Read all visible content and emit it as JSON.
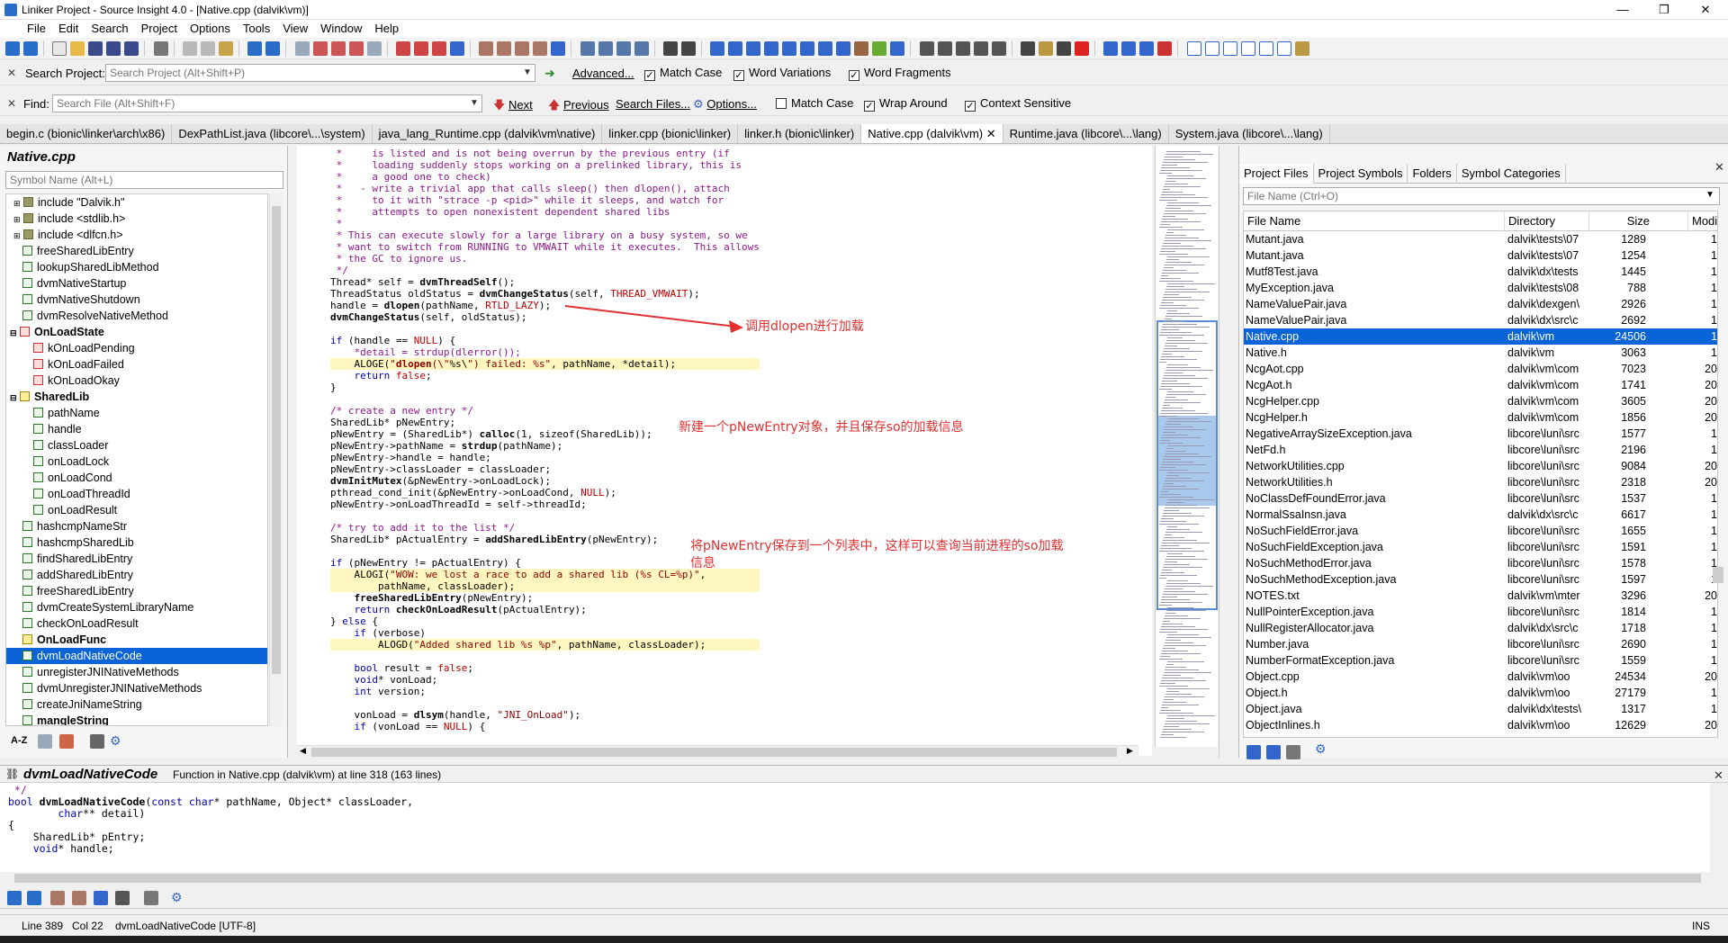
{
  "window": {
    "title": "Liniker Project - Source Insight 4.0 - [Native.cpp (dalvik\\vm)]",
    "minimize": "—",
    "restore": "❐",
    "close": "✕"
  },
  "menu": [
    "File",
    "Edit",
    "Search",
    "Project",
    "Options",
    "Tools",
    "View",
    "Window",
    "Help"
  ],
  "search_project": {
    "label": "Search Project:",
    "placeholder": "Search Project (Alt+Shift+P)",
    "advanced": "Advanced...",
    "match_case": "Match Case",
    "word_variations": "Word Variations",
    "word_fragments": "Word Fragments"
  },
  "find": {
    "label": "Find:",
    "placeholder": "Search File (Alt+Shift+F)",
    "next": "Next",
    "previous": "Previous",
    "search_files": "Search Files...",
    "options": "Options...",
    "match_case": "Match Case",
    "wrap_around": "Wrap Around",
    "context_sensitive": "Context Sensitive"
  },
  "file_tabs": [
    {
      "label": "begin.c (bionic\\linker\\arch\\x86)"
    },
    {
      "label": "DexPathList.java (libcore\\...\\system)"
    },
    {
      "label": "java_lang_Runtime.cpp (dalvik\\vm\\native)"
    },
    {
      "label": "linker.cpp (bionic\\linker)"
    },
    {
      "label": "linker.h (bionic\\linker)"
    },
    {
      "label": "Native.cpp (dalvik\\vm)",
      "close": "✕"
    },
    {
      "label": "Runtime.java (libcore\\...\\lang)"
    },
    {
      "label": "System.java (libcore\\...\\lang)"
    }
  ],
  "symbol_panel": {
    "title": "Native.cpp",
    "placeholder": "Symbol Name (Alt+L)",
    "symbols": [
      "include \"Dalvik.h\"",
      "include <stdlib.h>",
      "include <dlfcn.h>",
      "freeSharedLibEntry",
      "lookupSharedLibMethod",
      "dvmNativeStartup",
      "dvmNativeShutdown",
      "dvmResolveNativeMethod",
      "OnLoadState",
      "kOnLoadPending",
      "kOnLoadFailed",
      "kOnLoadOkay",
      "SharedLib",
      "pathName",
      "handle",
      "classLoader",
      "onLoadLock",
      "onLoadCond",
      "onLoadThreadId",
      "onLoadResult",
      "hashcmpNameStr",
      "hashcmpSharedLib",
      "findSharedLibEntry",
      "addSharedLibEntry",
      "freeSharedLibEntry",
      "dvmCreateSystemLibraryName",
      "checkOnLoadResult",
      "OnLoadFunc",
      "dvmLoadNativeCode",
      "unregisterJNINativeMethods",
      "dvmUnregisterJNINativeMethods",
      "createJniNameString",
      "mangleString"
    ],
    "az": "A-Z"
  },
  "code": {
    "lines": [
      " *     is listed and is not being overrun by the previous entry (if",
      " *     loading suddenly stops working on a prelinked library, this is",
      " *     a good one to check)",
      " *   - write a trivial app that calls sleep() then dlopen(), attach",
      " *     to it with \"strace -p <pid>\" while it sleeps, and watch for",
      " *     attempts to open nonexistent dependent shared libs",
      " *",
      " * This can execute slowly for a large library on a busy system, so we",
      " * want to switch from RUNNING to VMWAIT while it executes.  This allows",
      " * the GC to ignore us.",
      " */",
      "Thread* self = dvmThreadSelf();",
      "ThreadStatus oldStatus = dvmChangeStatus(self, THREAD_VMWAIT);",
      "handle = dlopen(pathName, RTLD_LAZY);",
      "dvmChangeStatus(self, oldStatus);",
      "",
      "if (handle == NULL) {",
      "    *detail = strdup(dlerror());",
      "    ALOGE(\"dlopen(\\\"%s\\\") failed: %s\", pathName, *detail);",
      "    return false;",
      "}",
      "",
      "/* create a new entry */",
      "SharedLib* pNewEntry;",
      "pNewEntry = (SharedLib*) calloc(1, sizeof(SharedLib));",
      "pNewEntry->pathName = strdup(pathName);",
      "pNewEntry->handle = handle;",
      "pNewEntry->classLoader = classLoader;",
      "dvmInitMutex(&pNewEntry->onLoadLock);",
      "pthread_cond_init(&pNewEntry->onLoadCond, NULL);",
      "pNewEntry->onLoadThreadId = self->threadId;",
      "",
      "/* try to add it to the list */",
      "SharedLib* pActualEntry = addSharedLibEntry(pNewEntry);",
      "",
      "if (pNewEntry != pActualEntry) {",
      "    ALOGI(\"WOW: we lost a race to add a shared lib (%s CL=%p)\",",
      "        pathName, classLoader);",
      "    freeSharedLibEntry(pNewEntry);",
      "    return checkOnLoadResult(pActualEntry);",
      "} else {",
      "    if (verbose)",
      "        ALOGD(\"Added shared lib %s %p\", pathName, classLoader);",
      "",
      "    bool result = false;",
      "    void* vonLoad;",
      "    int version;",
      "",
      "    vonLoad = dlsym(handle, \"JNI_OnLoad\");",
      "    if (vonLoad == NULL) {"
    ]
  },
  "annotations": {
    "dlopen": "调用dlopen进行加载",
    "new_entry": "新建一个pNewEntry对象，并且保存so的加载信息",
    "list_line1": "将pNewEntry保存到一个列表中，这样可以查询当前进程的so加载",
    "list_line2": "信息"
  },
  "project_panel": {
    "tabs": [
      "Project Files",
      "Project Symbols",
      "Folders",
      "Symbol Categories"
    ],
    "placeholder": "File Name (Ctrl+O)",
    "columns": [
      "File Name",
      "Directory",
      "Size",
      "Modifi"
    ],
    "files": [
      [
        "Mutant.java",
        "dalvik\\tests\\07",
        "1289",
        "1"
      ],
      [
        "Mutant.java",
        "dalvik\\tests\\07",
        "1254",
        "1"
      ],
      [
        "Mutf8Test.java",
        "dalvik\\dx\\tests",
        "1445",
        "1"
      ],
      [
        "MyException.java",
        "dalvik\\tests\\08",
        "788",
        "1"
      ],
      [
        "NameValuePair.java",
        "dalvik\\dexgen\\",
        "2926",
        "1"
      ],
      [
        "NameValuePair.java",
        "dalvik\\dx\\src\\c",
        "2692",
        "1"
      ],
      [
        "Native.cpp",
        "dalvik\\vm",
        "24506",
        "1"
      ],
      [
        "Native.h",
        "dalvik\\vm",
        "3063",
        "1"
      ],
      [
        "NcgAot.cpp",
        "dalvik\\vm\\com",
        "7023",
        "20"
      ],
      [
        "NcgAot.h",
        "dalvik\\vm\\com",
        "1741",
        "20"
      ],
      [
        "NcgHelper.cpp",
        "dalvik\\vm\\com",
        "3605",
        "20"
      ],
      [
        "NcgHelper.h",
        "dalvik\\vm\\com",
        "1856",
        "20"
      ],
      [
        "NegativeArraySizeException.java",
        "libcore\\luni\\src",
        "1577",
        "1"
      ],
      [
        "NetFd.h",
        "libcore\\luni\\src",
        "2196",
        "1"
      ],
      [
        "NetworkUtilities.cpp",
        "libcore\\luni\\src",
        "9084",
        "20"
      ],
      [
        "NetworkUtilities.h",
        "libcore\\luni\\src",
        "2318",
        "20"
      ],
      [
        "NoClassDefFoundError.java",
        "libcore\\luni\\src",
        "1537",
        "1"
      ],
      [
        "NormalSsaInsn.java",
        "dalvik\\dx\\src\\c",
        "6617",
        "1"
      ],
      [
        "NoSuchFieldError.java",
        "libcore\\luni\\src",
        "1655",
        "1"
      ],
      [
        "NoSuchFieldException.java",
        "libcore\\luni\\src",
        "1591",
        "1"
      ],
      [
        "NoSuchMethodError.java",
        "libcore\\luni\\src",
        "1578",
        "1"
      ],
      [
        "NoSuchMethodException.java",
        "libcore\\luni\\src",
        "1597",
        "1"
      ],
      [
        "NOTES.txt",
        "dalvik\\vm\\mter",
        "3296",
        "20"
      ],
      [
        "NullPointerException.java",
        "libcore\\luni\\src",
        "1814",
        "1"
      ],
      [
        "NullRegisterAllocator.java",
        "dalvik\\dx\\src\\c",
        "1718",
        "1"
      ],
      [
        "Number.java",
        "libcore\\luni\\src",
        "2690",
        "1"
      ],
      [
        "NumberFormatException.java",
        "libcore\\luni\\src",
        "1559",
        "1"
      ],
      [
        "Object.cpp",
        "dalvik\\vm\\oo",
        "24534",
        "20"
      ],
      [
        "Object.h",
        "dalvik\\vm\\oo",
        "27179",
        "1"
      ],
      [
        "Object.java",
        "dalvik\\dx\\tests\\",
        "1317",
        "1"
      ],
      [
        "ObjectInlines.h",
        "dalvik\\vm\\oo",
        "12629",
        "20"
      ]
    ]
  },
  "context_window": {
    "function_name": "dvmLoadNativeCode",
    "description": "Function in Native.cpp (dalvik\\vm) at line 318 (163 lines)",
    "code_lines": [
      " */",
      "bool dvmLoadNativeCode(const char* pathName, Object* classLoader,",
      "        char** detail)",
      "{",
      "    SharedLib* pEntry;",
      "    void* handle;"
    ]
  },
  "status": {
    "line": "Line 389",
    "col": "Col 22",
    "func": "dvmLoadNativeCode [UTF-8]",
    "mode": "INS"
  }
}
